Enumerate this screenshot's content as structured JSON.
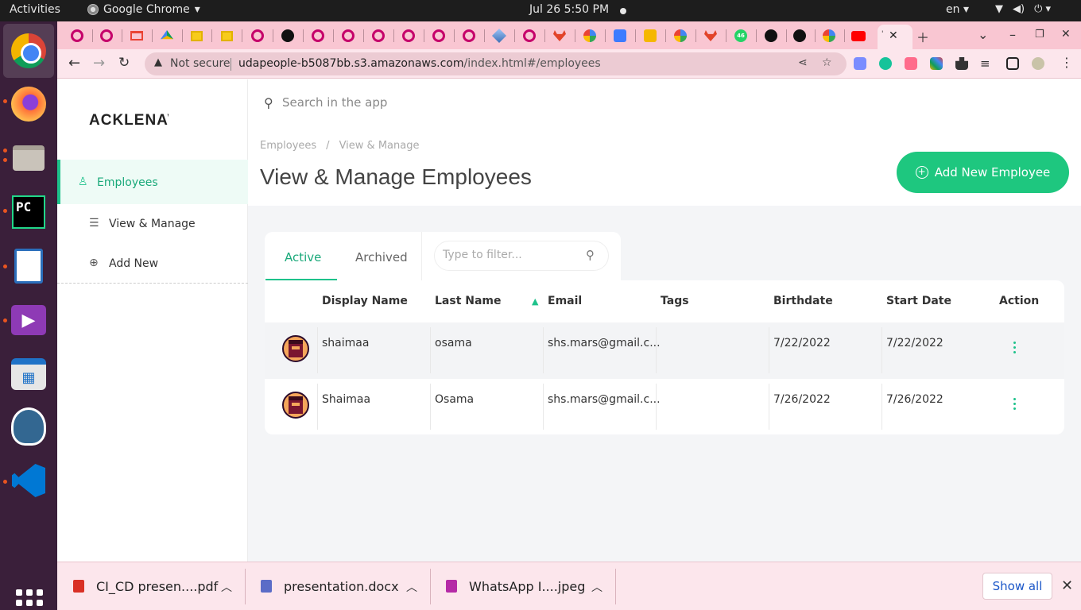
{
  "system": {
    "activities": "Activities",
    "app_name": "Google Chrome",
    "clock": "Jul 26  5:50 PM",
    "lang": "en",
    "icons": [
      "wifi-icon",
      "volume-icon",
      "power-icon"
    ]
  },
  "dock": {
    "apps": [
      "chrome-icon",
      "firefox-icon",
      "files-icon",
      "pycharm-icon",
      "writer-icon",
      "video-icon",
      "software-store-icon",
      "postgres-icon",
      "vscode-icon"
    ],
    "pycharm_text": "PC"
  },
  "browser": {
    "active_tab_title": "'",
    "not_secure": "Not secure",
    "url_host": "udapeople-b5087bb.s3.amazonaws.com",
    "url_path": "/index.html#/employees"
  },
  "sidebar": {
    "logo": "ACKLENAVENUE",
    "main_item": "Employees",
    "items": [
      {
        "label": "View & Manage",
        "icon": "list-icon"
      },
      {
        "label": "Add New",
        "icon": "plus-circle-icon"
      }
    ]
  },
  "header": {
    "search_placeholder": "Search in the app",
    "breadcrumb": [
      "Employees",
      "/",
      "View & Manage"
    ],
    "title": "View & Manage Employees",
    "add_button": "Add New Employee"
  },
  "tabs": {
    "active": "Active",
    "archived": "Archived",
    "filter_placeholder": "Type to filter..."
  },
  "table": {
    "columns": [
      "Display Name",
      "Last Name",
      "Email",
      "Tags",
      "Birthdate",
      "Start Date",
      "Action"
    ],
    "rows": [
      {
        "display_name": "shaimaa",
        "last_name": "osama",
        "email": "shs.mars@gmail.c...",
        "tags": "",
        "birthdate": "7/22/2022",
        "start_date": "7/22/2022"
      },
      {
        "display_name": "Shaimaa",
        "last_name": "Osama",
        "email": "shs.mars@gmail.c...",
        "tags": "",
        "birthdate": "7/26/2022",
        "start_date": "7/26/2022"
      }
    ]
  },
  "downloads": {
    "items": [
      {
        "name": "CI_CD presen....pdf",
        "icon": "pdf-icon",
        "color": "#d93025"
      },
      {
        "name": "presentation.docx",
        "icon": "docx-icon",
        "color": "#5b6cc7"
      },
      {
        "name": "WhatsApp I....jpeg",
        "icon": "image-icon",
        "color": "#b52aa6"
      }
    ],
    "show_all": "Show all"
  },
  "colors": {
    "accent": "#1ec28b",
    "button": "#1ec77f",
    "tab_bar": "#f9c6d2"
  }
}
